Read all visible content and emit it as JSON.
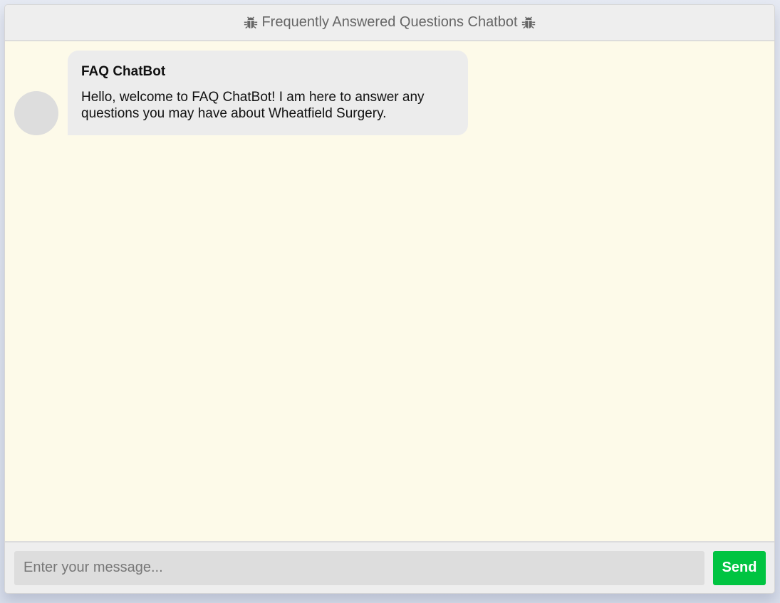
{
  "header": {
    "title": "Frequently Answered Questions Chatbot",
    "left_icon": "bug-icon",
    "right_icon": "bug-icon"
  },
  "messages": [
    {
      "sender": "FAQ ChatBot",
      "text": "Hello, welcome to FAQ ChatBot! I am here to answer any questions you may have about Wheatfield Surgery."
    }
  ],
  "input": {
    "placeholder": "Enter your message...",
    "value": ""
  },
  "send_button": {
    "label": "Send"
  },
  "colors": {
    "chat_background": "#fdfae9",
    "header_background": "#eeeeee",
    "bubble_background": "#ececec",
    "send_button": "#00c441"
  }
}
